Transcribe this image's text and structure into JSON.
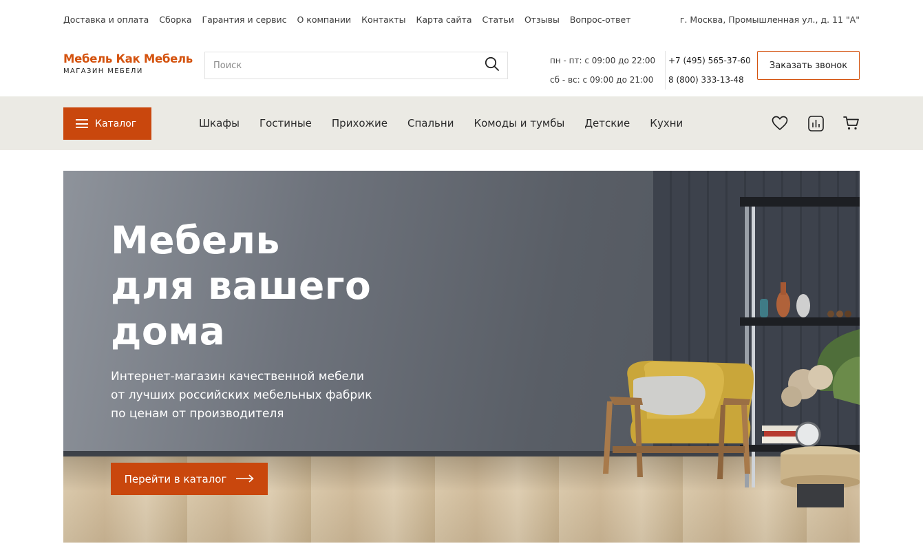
{
  "topbar": {
    "links": [
      "Доставка и оплата",
      "Сборка",
      "Гарантия и сервис",
      "О компании",
      "Контакты",
      "Карта сайта",
      "Статьи",
      "Отзывы",
      "Вопрос-ответ"
    ],
    "address": "г. Москва, Промышленная ул., д. 11 \"А\""
  },
  "header": {
    "logo_name": "Мебель Как Мебель",
    "logo_subtitle": "МАГАЗИН МЕБЕЛИ",
    "search_placeholder": "Поиск",
    "search_icon": "search-icon",
    "hours_weekdays": "пн - пт: с 09:00 до 22:00",
    "hours_weekend": "сб - вс: с 09:00 до 21:00",
    "phone_1": "+7 (495) 565-37-60",
    "phone_2": "8 (800) 333-13-48",
    "callback_label": "Заказать звонок"
  },
  "nav": {
    "catalog_label": "Каталог",
    "items": [
      "Шкафы",
      "Гостиные",
      "Прихожие",
      "Спальни",
      "Комоды и тумбы",
      "Детские",
      "Кухни"
    ],
    "icons": [
      "heart-icon",
      "compare-icon",
      "cart-icon"
    ]
  },
  "hero": {
    "title_lines": [
      "Мебель",
      "для вашего",
      "дома"
    ],
    "text_lines": [
      "Интернет-магазин качественной мебели",
      "от лучших российских мебельных фабрик",
      "по ценам от производителя"
    ],
    "button_label": "Перейти в каталог"
  },
  "colors": {
    "accent": "#c9470d",
    "logo": "#d4530f",
    "nav_bg": "#ebeae4"
  }
}
